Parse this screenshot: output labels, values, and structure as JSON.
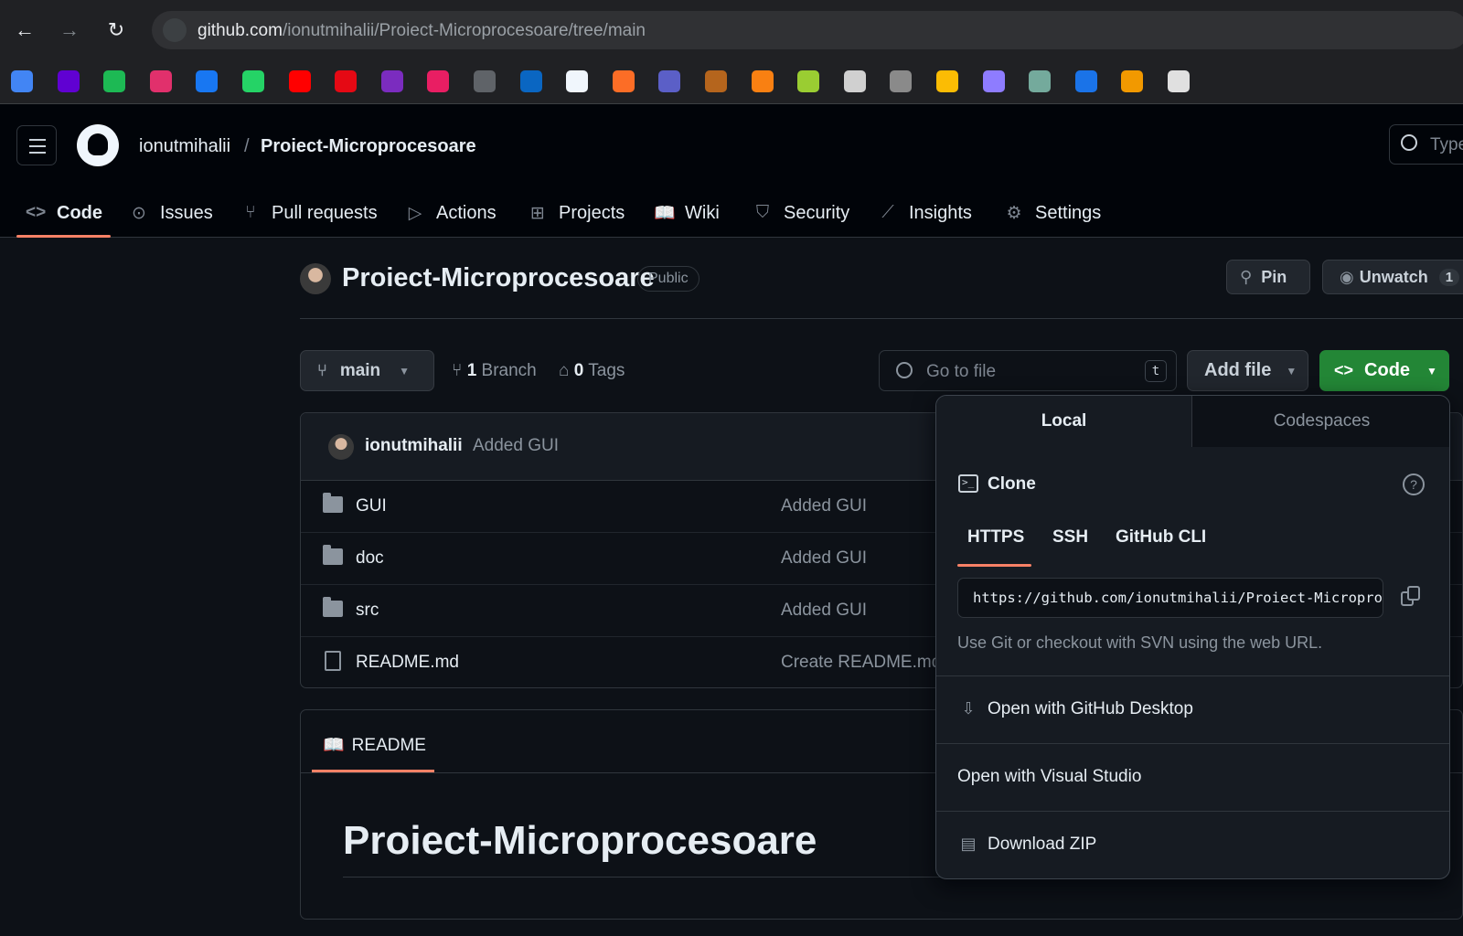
{
  "browser": {
    "url_host": "github.com",
    "url_path": "/ionutmihalii/Proiect-Microprocesoare/tree/main",
    "bookmarks": [
      {
        "icon": "translate-icon",
        "color": "#4285f4"
      },
      {
        "icon": "mail-icon",
        "color": "#6001d2"
      },
      {
        "icon": "circle-icon",
        "color": "#1db954"
      },
      {
        "icon": "instagram-icon",
        "color": "#e1306c"
      },
      {
        "icon": "facebook-icon",
        "color": "#1877f2"
      },
      {
        "icon": "whatsapp-icon",
        "color": "#25d366"
      },
      {
        "icon": "youtube-icon",
        "color": "#ff0000"
      },
      {
        "icon": "netflix-icon",
        "color": "#e50914"
      },
      {
        "icon": "m-icon",
        "color": "#7b2cbf"
      },
      {
        "icon": "play-icon",
        "color": "#e91e63"
      },
      {
        "icon": "cisco-icon",
        "color": "#5f6368"
      },
      {
        "icon": "linkedin-icon",
        "color": "#0a66c2"
      },
      {
        "icon": "github-icon",
        "color": "#f0f6fc"
      },
      {
        "icon": "gitlab-icon",
        "color": "#fc6d26"
      },
      {
        "icon": "teams-icon",
        "color": "#5b5fc7"
      },
      {
        "icon": "notebook-icon",
        "color": "#b5651d"
      },
      {
        "icon": "moodle-icon",
        "color": "#f98012"
      },
      {
        "icon": "cube-icon",
        "color": "#9acd32"
      },
      {
        "icon": "shirt-icon",
        "color": "#d0d0d0"
      },
      {
        "icon": "discord-icon",
        "color": "#8a8a8a"
      },
      {
        "icon": "drive-icon",
        "color": "#fbbc04"
      },
      {
        "icon": "gemini-icon",
        "color": "#8e7cff"
      },
      {
        "icon": "chatgpt-icon",
        "color": "#74aa9c"
      },
      {
        "icon": "share-icon",
        "color": "#1a73e8"
      },
      {
        "icon": "draw-icon",
        "color": "#f29900"
      },
      {
        "icon": "co-icon",
        "color": "#e0e0e0"
      }
    ]
  },
  "header": {
    "owner": "ionutmihalii",
    "separator": "/",
    "repo": "Proiect-Microprocesoare",
    "search_placeholder": "Type"
  },
  "tabs": [
    {
      "label": "Code",
      "icon": "code-icon",
      "glyph": "<>"
    },
    {
      "label": "Issues",
      "icon": "issue-icon",
      "glyph": "⊙"
    },
    {
      "label": "Pull requests",
      "icon": "pull-request-icon",
      "glyph": "⑂"
    },
    {
      "label": "Actions",
      "icon": "play-icon",
      "glyph": "▷"
    },
    {
      "label": "Projects",
      "icon": "table-icon",
      "glyph": "⊞"
    },
    {
      "label": "Wiki",
      "icon": "book-icon",
      "glyph": "📖"
    },
    {
      "label": "Security",
      "icon": "shield-icon",
      "glyph": "⛉"
    },
    {
      "label": "Insights",
      "icon": "graph-icon",
      "glyph": "⟋"
    },
    {
      "label": "Settings",
      "icon": "gear-icon",
      "glyph": "⚙"
    }
  ],
  "repo": {
    "title": "Proiect-Microprocesoare",
    "visibility": "Public",
    "pin_label": "Pin",
    "unwatch_label": "Unwatch",
    "watch_count": "1"
  },
  "toolbar": {
    "branch": "main",
    "branch_count": "1",
    "branch_label": "Branch",
    "tag_count": "0",
    "tag_label": "Tags",
    "goto_placeholder": "Go to file",
    "goto_shortcut": "t",
    "add_file_label": "Add file",
    "code_label": "Code"
  },
  "commit": {
    "author": "ionutmihalii",
    "message": "Added GUI"
  },
  "files": [
    {
      "name": "GUI",
      "type": "folder",
      "message": "Added GUI"
    },
    {
      "name": "doc",
      "type": "folder",
      "message": "Added GUI"
    },
    {
      "name": "src",
      "type": "folder",
      "message": "Added GUI"
    },
    {
      "name": "README.md",
      "type": "file",
      "message": "Create README.md"
    }
  ],
  "readme": {
    "tab_label": "README",
    "heading": "Proiect-Microprocesoare"
  },
  "dropdown": {
    "tab_local": "Local",
    "tab_codespaces": "Codespaces",
    "clone_title": "Clone",
    "protocols": [
      "HTTPS",
      "SSH",
      "GitHub CLI"
    ],
    "clone_url": "https://github.com/ionutmihalii/Proiect-Microprocesoare.git",
    "hint": "Use Git or checkout with SVN using the web URL.",
    "open_desktop": "Open with GitHub Desktop",
    "open_vs": "Open with Visual Studio",
    "download_zip": "Download ZIP"
  },
  "colors": {
    "accent_underline": "#f78166",
    "code_button": "#238636",
    "background": "#0d1117"
  }
}
